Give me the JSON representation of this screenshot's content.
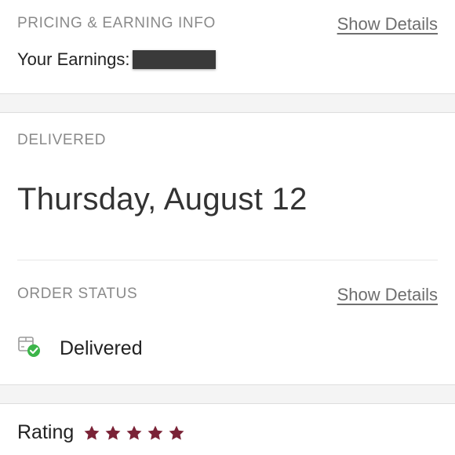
{
  "pricing": {
    "label": "PRICING & EARNING INFO",
    "details_link": "Show Details",
    "earnings_label": "Your Earnings:"
  },
  "delivered": {
    "label": "DELIVERED",
    "date": "Thursday, August 12"
  },
  "order_status": {
    "label": "ORDER STATUS",
    "details_link": "Show Details",
    "status": "Delivered",
    "status_color": "#3cb54a"
  },
  "rating": {
    "label": "Rating",
    "stars": 5,
    "star_color": "#7a2236"
  }
}
